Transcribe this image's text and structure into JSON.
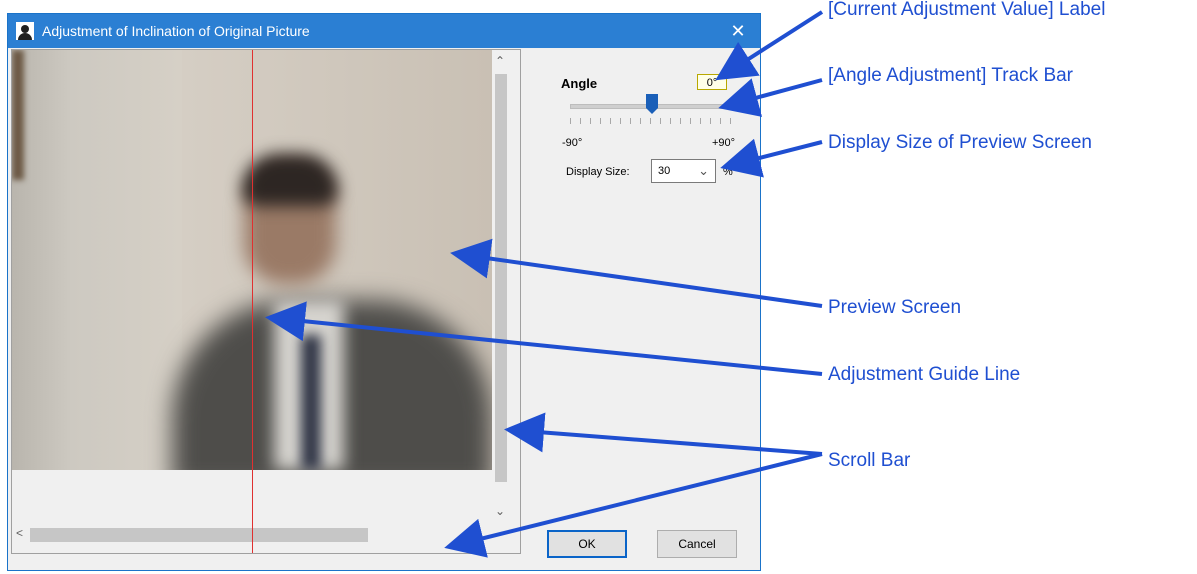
{
  "dialog": {
    "title": "Adjustment of Inclination of Original Picture",
    "close_glyph": "✕",
    "icon": "person-icon"
  },
  "controls": {
    "angle_label": "Angle",
    "angle_value": "0°",
    "slider_min_label": "-90°",
    "slider_max_label": "+90°",
    "slider_value_degrees": 0,
    "display_size_label": "Display Size:",
    "display_size_value": "30",
    "percent_label": "%"
  },
  "buttons": {
    "ok": "OK",
    "cancel": "Cancel"
  },
  "scrollbars": {
    "up": "⌃",
    "down": "⌄",
    "left": "<",
    "right": ">"
  },
  "annotations": {
    "current_value_label": "[Current Adjustment Value] Label",
    "angle_track_bar": "[Angle Adjustment] Track Bar",
    "display_size": "Display Size of Preview Screen",
    "preview_screen": "Preview Screen",
    "guide_line": "Adjustment Guide Line",
    "scroll_bar": "Scroll Bar"
  },
  "colors": {
    "titlebar": "#2b7fd3",
    "annotation": "#1f4fd1",
    "guide_line": "#e03030",
    "slider_thumb": "#1a5fb8"
  }
}
